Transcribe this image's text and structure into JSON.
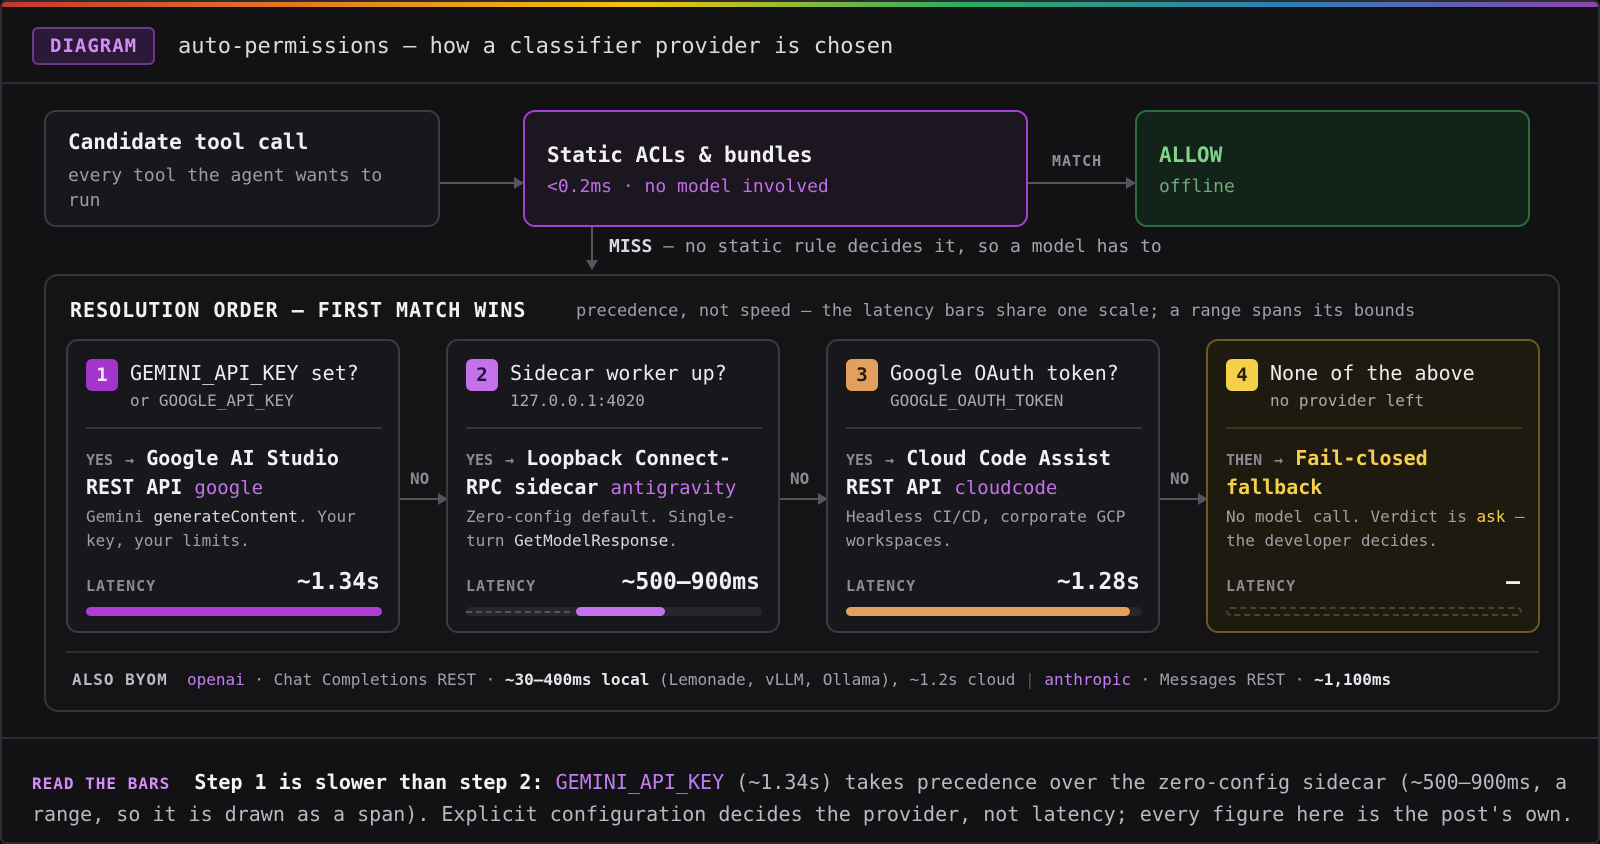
{
  "header": {
    "badge": "DIAGRAM",
    "title": "auto-permissions — how a classifier provider is chosen"
  },
  "candidate": {
    "title": "Candidate tool call",
    "sub": "every tool the agent wants to run"
  },
  "static": {
    "title": "Static ACLs & bundles",
    "sub": "<0.2ms · no model involved"
  },
  "match_label": "MATCH",
  "allow": {
    "title": "ALLOW",
    "sub": "offline"
  },
  "miss": {
    "label": "MISS",
    "text": " — no static rule decides it, so a model has to"
  },
  "resolution": {
    "title": "RESOLUTION ORDER — FIRST MATCH WINS",
    "subtitle": "precedence, not speed — the latency bars share one scale; a range spans its bounds"
  },
  "no_label": "NO",
  "latency_label": "LATENCY",
  "steps": [
    {
      "num": "1",
      "question": "GEMINI_API_KEY set?",
      "env": "or GOOGLE_API_KEY",
      "yes": "YES",
      "arrow": "→",
      "result": "Google AI Studio REST API",
      "tag": "google",
      "desc_a": "Gemini ",
      "desc_code": "generateContent",
      "desc_b": ". Your key, your limits.",
      "latency": "~1.34s",
      "fill_from": 0.0,
      "fill_to": 1.0
    },
    {
      "num": "2",
      "question": "Sidecar worker up?",
      "env": "127.0.0.1:4020",
      "yes": "YES",
      "arrow": "→",
      "result": "Loopback Connect-RPC sidecar",
      "tag": "antigravity",
      "desc_a": "Zero-config default. Single-turn ",
      "desc_code": "GetModelResponse",
      "desc_b": ".",
      "latency": "~500–900ms",
      "fill_from": 0.37,
      "fill_to": 0.67
    },
    {
      "num": "3",
      "question": "Google OAuth token?",
      "env": "GOOGLE_OAUTH_TOKEN",
      "yes": "YES",
      "arrow": "→",
      "result": "Cloud Code Assist REST API",
      "tag": "cloudcode",
      "desc_a": "Headless CI/CD, corporate GCP workspaces.",
      "desc_code": "",
      "desc_b": "",
      "latency": "~1.28s",
      "fill_from": 0.0,
      "fill_to": 0.96
    },
    {
      "num": "4",
      "question": "None of the above",
      "env": "no provider left",
      "yes": "THEN",
      "arrow": "→",
      "result": "Fail-closed fallback",
      "tag": "",
      "desc_a": "No model call. Verdict is ",
      "desc_code": "ask",
      "desc_b": " — the developer decides.",
      "latency": "—",
      "fill_from": 0.0,
      "fill_to": 0.0
    }
  ],
  "byom": {
    "label": "ALSO BYOM",
    "p1_name": "openai",
    "p1_desc": " · Chat Completions REST · ",
    "p1_local": "~30–400ms local",
    "p1_rest": " (Lemonade, vLLM, Ollama), ~1.2s cloud ",
    "sep": "|",
    "p2_name": "anthropic",
    "p2_desc": " · Messages REST · ",
    "p2_lat": "~1,100ms"
  },
  "read_bars": {
    "label": "READ THE BARS",
    "lead": "Step 1 is slower than step 2: ",
    "key": "GEMINI_API_KEY",
    "body": " (~1.34s) takes precedence over the zero-config sidecar (~500–900ms, a range, so it is drawn as a span). Explicit configuration decides the provider, not latency; every figure here is the post's own."
  },
  "colors": {
    "purple": "#b03cd6",
    "lilac": "#c472ec",
    "orange": "#e2a05c",
    "gold": "#f5d04a",
    "allow_green": "#7fd48a",
    "static_border": "#a53fd9"
  }
}
